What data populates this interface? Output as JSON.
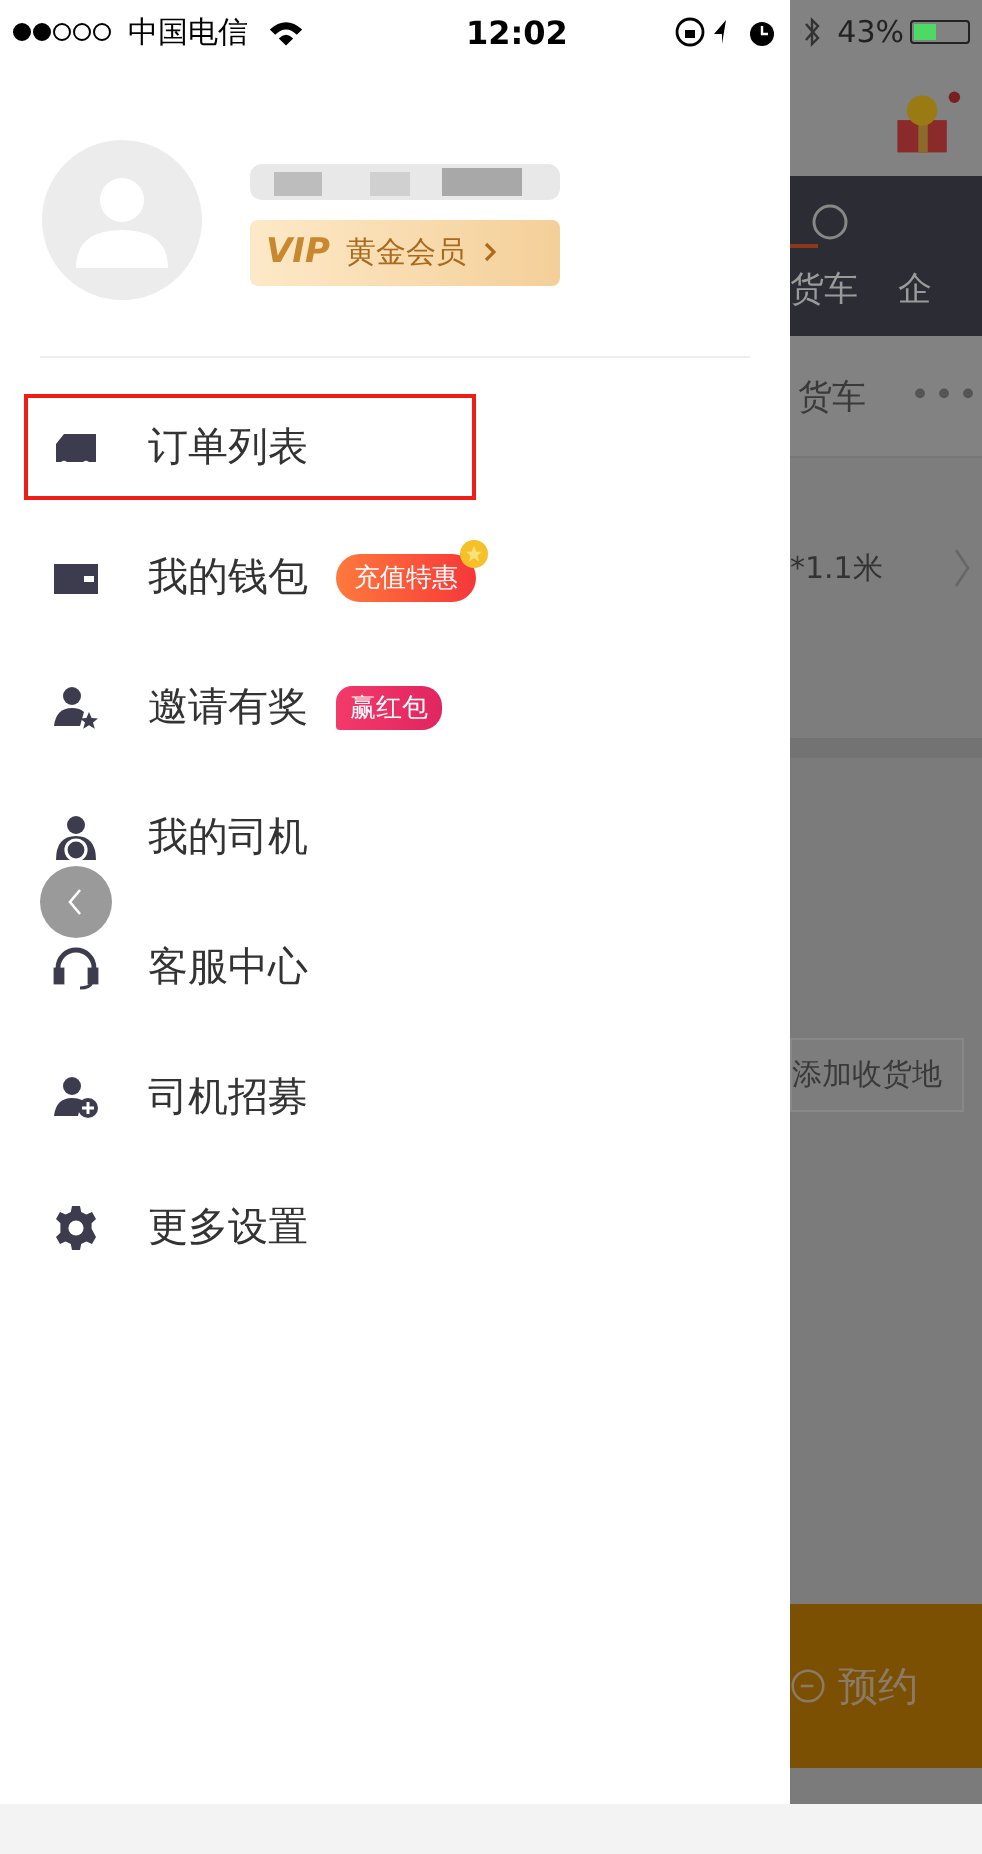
{
  "status_bar": {
    "carrier": "中国电信",
    "time": "12:02",
    "battery": "43%"
  },
  "profile": {
    "vip_mark": "VIP",
    "vip_text": "黄金会员"
  },
  "menu": [
    {
      "label": "订单列表",
      "kind": "truck",
      "highlighted": true
    },
    {
      "label": "我的钱包",
      "kind": "wallet",
      "highlighted": false,
      "badge": {
        "text": "充值特惠",
        "kind": "promo"
      }
    },
    {
      "label": "邀请有奖",
      "kind": "invite",
      "highlighted": false,
      "badge": {
        "text": "赢红包",
        "kind": "redpacket"
      }
    },
    {
      "label": "我的司机",
      "kind": "driver",
      "highlighted": false
    },
    {
      "label": "客服中心",
      "kind": "headset",
      "highlighted": false
    },
    {
      "label": "司机招募",
      "kind": "recruit",
      "highlighted": false
    },
    {
      "label": "更多设置",
      "kind": "gear",
      "highlighted": false
    }
  ],
  "background_app": {
    "nav_items": [
      "货车",
      "企"
    ],
    "tab_text": "货车",
    "more": "•••",
    "size_text": "*1.1米",
    "add_button": "添加收货地",
    "book_button": "预约"
  }
}
